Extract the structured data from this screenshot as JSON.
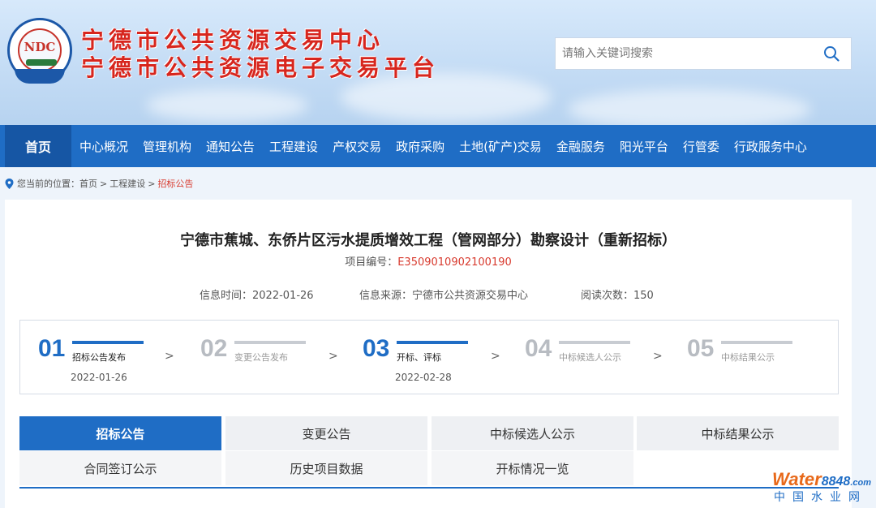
{
  "header": {
    "title_line1": "宁德市公共资源交易中心",
    "title_line2": "宁德市公共资源电子交易平台",
    "search_placeholder": "请输入关键词搜索",
    "logo_letters": "NDC"
  },
  "nav": {
    "home": "首页",
    "items": [
      "中心概况",
      "管理机构",
      "通知公告",
      "工程建设",
      "产权交易",
      "政府采购",
      "土地(矿产)交易",
      "金融服务",
      "阳光平台",
      "行管委",
      "行政服务中心"
    ]
  },
  "breadcrumb": {
    "prefix": "您当前的位置：",
    "items": [
      "首页",
      "工程建设",
      "招标公告"
    ]
  },
  "announcement": {
    "title": "宁德市蕉城、东侨片区污水提质增效工程（管网部分）勘察设计（重新招标）",
    "project_no_label": "项目编号：",
    "project_no": "E3509010902100190",
    "info_time": "信息时间：2022-01-26",
    "info_source": "信息来源：宁德市公共资源交易中心",
    "read_count": "阅读次数：150"
  },
  "steps": [
    {
      "num": "01",
      "label": "招标公告发布",
      "date": "2022-01-26",
      "active": true
    },
    {
      "num": "02",
      "label": "变更公告发布",
      "date": "",
      "active": false
    },
    {
      "num": "03",
      "label": "开标、评标",
      "date": "2022-02-28",
      "active": true
    },
    {
      "num": "04",
      "label": "中标候选人公示",
      "date": "",
      "active": false
    },
    {
      "num": "05",
      "label": "中标结果公示",
      "date": "",
      "active": false
    }
  ],
  "tabs": {
    "row1": [
      "招标公告",
      "变更公告",
      "中标候选人公示",
      "中标结果公示"
    ],
    "row2": [
      "合同签订公示",
      "历史项目数据",
      "开标情况一览"
    ]
  },
  "watermark": {
    "brand_a": "Water",
    "brand_b": "8848",
    "brand_c": ".com",
    "cn": "中国水业网"
  },
  "colors": {
    "primary_blue": "#1f6dc5",
    "title_red": "#d7261e",
    "highlight_red": "#d83a2e"
  }
}
